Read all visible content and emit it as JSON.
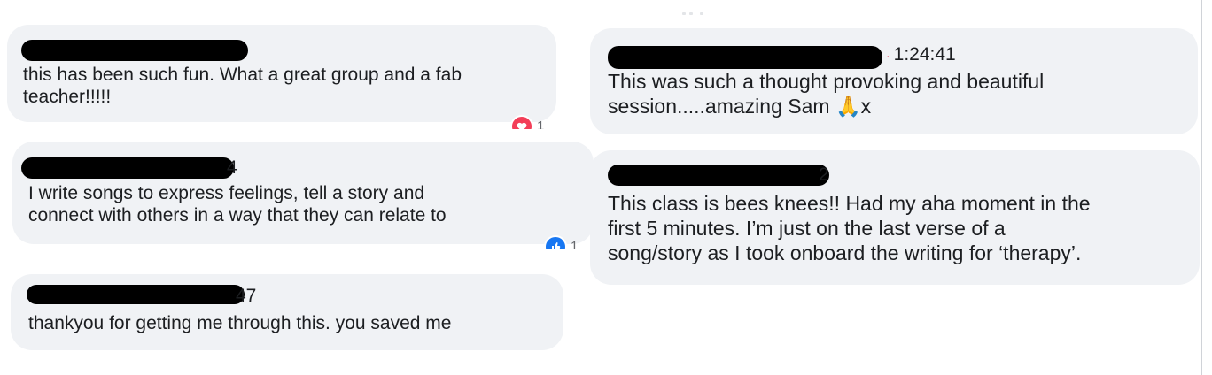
{
  "comments_left": [
    {
      "timestamp": "",
      "text": "this has been such fun. What a great group and a fab\nteacher!!!!!",
      "reaction": {
        "icon": "heart-icon",
        "count": "1"
      }
    },
    {
      "timestamp": "4",
      "text": "I write songs to express feelings, tell a story and\nconnect with others in a way that they can relate to",
      "reaction": {
        "icon": "like-icon",
        "count": "1"
      }
    },
    {
      "timestamp": "47",
      "text": "thankyou for getting me through this. you saved me"
    }
  ],
  "comments_right": [
    {
      "separator": "·",
      "timestamp": "1:24:41",
      "text": "This was such a thought provoking and beautiful\nsession.....amazing Sam 🙏x"
    },
    {
      "timestamp": "2",
      "text": "This class is bees knees!! Had my aha moment in the\nfirst 5 minutes. I’m just on the last verse of a\nsong/story as I took onboard the writing for ‘therapy’."
    }
  ],
  "colors": {
    "bubble": "#f0f2f5",
    "heart": "#f33e58",
    "like": "#1877f2"
  }
}
